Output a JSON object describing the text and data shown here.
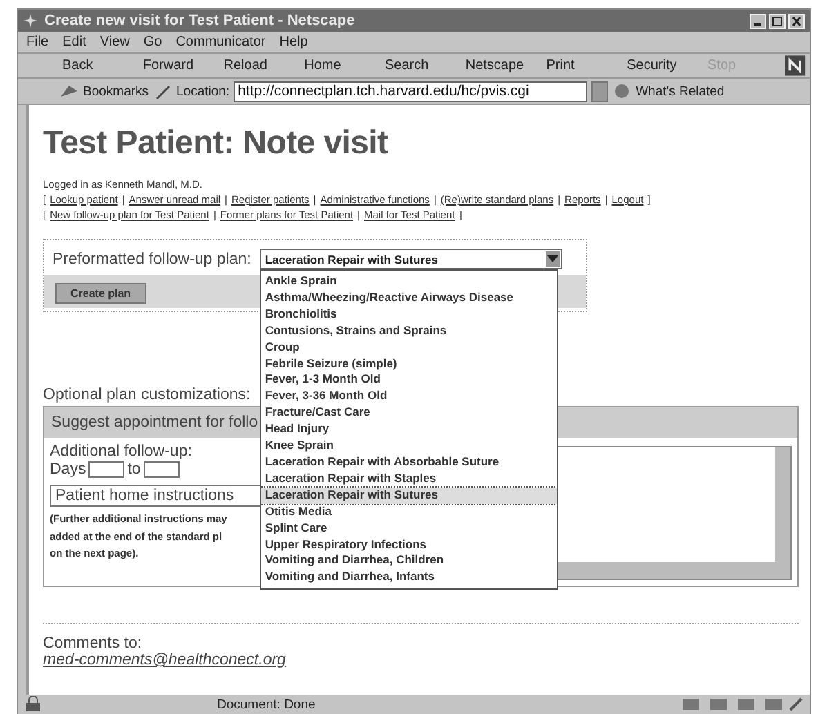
{
  "window": {
    "title": "Create new visit for Test Patient - Netscape"
  },
  "menu": [
    "File",
    "Edit",
    "View",
    "Go",
    "Communicator",
    "Help"
  ],
  "toolbar": [
    {
      "label": "Back",
      "disabled": false
    },
    {
      "label": "Forward",
      "disabled": false
    },
    {
      "label": "Reload",
      "disabled": false
    },
    {
      "label": "Home",
      "disabled": false
    },
    {
      "label": "Search",
      "disabled": false
    },
    {
      "label": "Netscape",
      "disabled": false
    },
    {
      "label": "Print",
      "disabled": false
    },
    {
      "label": "Security",
      "disabled": false
    },
    {
      "label": "Stop",
      "disabled": true
    }
  ],
  "location_bar": {
    "bookmarks": "Bookmarks",
    "label": "Location:",
    "url": "http://connectplan.tch.harvard.edu/hc/pvis.cgi",
    "related": "What's Related"
  },
  "page": {
    "heading": "Test Patient: Note visit",
    "logged_in": "Logged in as Kenneth Mandl, M.D.",
    "nav_rows": [
      [
        {
          "kind": "mark",
          "text": "["
        },
        {
          "kind": "link",
          "text": "Lookup patient"
        },
        {
          "kind": "mark",
          "text": "|"
        },
        {
          "kind": "link",
          "text": "Answer unread mail"
        },
        {
          "kind": "mark",
          "text": "|"
        },
        {
          "kind": "link",
          "text": "Register patients"
        },
        {
          "kind": "mark",
          "text": "|"
        },
        {
          "kind": "link",
          "text": "Administrative functions"
        },
        {
          "kind": "mark",
          "text": "|"
        },
        {
          "kind": "link",
          "text": "(Re)write standard plans"
        },
        {
          "kind": "mark",
          "text": "|"
        },
        {
          "kind": "link",
          "text": "Reports"
        },
        {
          "kind": "mark",
          "text": "|"
        },
        {
          "kind": "link",
          "text": "Logout"
        },
        {
          "kind": "mark",
          "text": "]"
        }
      ],
      [
        {
          "kind": "mark",
          "text": "["
        },
        {
          "kind": "link",
          "text": "New follow-up plan for Test Patient"
        },
        {
          "kind": "mark",
          "text": "|"
        },
        {
          "kind": "link",
          "text": "Former plans for Test Patient"
        },
        {
          "kind": "mark",
          "text": "|"
        },
        {
          "kind": "link",
          "text": "Mail for Test Patient"
        },
        {
          "kind": "mark",
          "text": "]"
        }
      ]
    ],
    "plan_form": {
      "label": "Preformatted follow-up plan:",
      "value": "Laceration Repair with Sutures",
      "button": "Create plan",
      "options": [
        {
          "label": "Ankle Sprain",
          "selected": false
        },
        {
          "label": "Asthma/Wheezing/Reactive Airways Disease",
          "selected": false
        },
        {
          "label": "Bronchiolitis",
          "selected": false
        },
        {
          "label": "Contusions, Strains and Sprains",
          "selected": false
        },
        {
          "label": "Croup",
          "selected": false
        },
        {
          "label": "Febrile Seizure (simple)",
          "selected": false
        },
        {
          "label": "Fever, 1-3 Month Old",
          "selected": false
        },
        {
          "label": "Fever, 3-36 Month Old",
          "selected": false
        },
        {
          "label": "Fracture/Cast Care",
          "selected": false
        },
        {
          "label": "Head Injury",
          "selected": false
        },
        {
          "label": "Knee Sprain",
          "selected": false
        },
        {
          "label": "Laceration Repair with Absorbable Suture",
          "selected": false
        },
        {
          "label": "Laceration Repair with Staples",
          "selected": false
        },
        {
          "label": "Laceration Repair with Sutures",
          "selected": true
        },
        {
          "label": "Otitis Media",
          "selected": false
        },
        {
          "label": "Splint Care",
          "selected": false
        },
        {
          "label": "Upper Respiratory Infections",
          "selected": false
        },
        {
          "label": "Vomiting and Diarrhea, Children",
          "selected": false
        },
        {
          "label": "Vomiting and Diarrhea, Infants",
          "selected": false
        }
      ]
    },
    "customizations": {
      "title": "Optional plan customizations:",
      "section": "Suggest appointment for follo",
      "additional": "Additional follow-up:",
      "days": "Days",
      "to": "to",
      "instructions": "Patient home instructions",
      "note_lines": [
        "(Further additional instructions may",
        "added at the end of the standard pl",
        "on the next page)."
      ]
    },
    "comments": {
      "label": "Comments to:",
      "email": "med-comments@healthconect.org"
    }
  },
  "status_bar": {
    "text": "Document: Done"
  }
}
